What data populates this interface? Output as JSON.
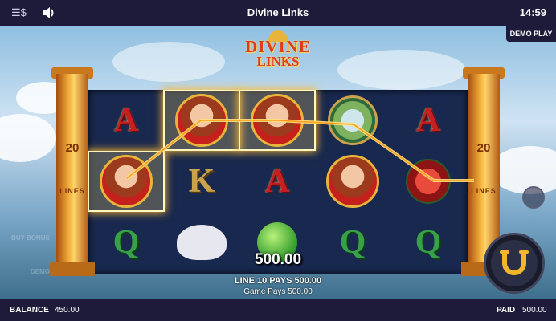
{
  "topbar": {
    "menu_icon": "menu-currency-icon",
    "sound_icon": "speaker-icon",
    "title": "Divine Links",
    "clock": "14:59"
  },
  "demo_badge": "DEMO PLAY",
  "logo": {
    "line1": "DIVINE",
    "line2": "LINKS"
  },
  "pillars": {
    "left_number": "20",
    "left_text": "LINES",
    "right_number": "20",
    "right_text": "LINES"
  },
  "reels": {
    "columns": [
      [
        "A",
        "goddess",
        "Q"
      ],
      [
        "goddess",
        "K",
        "dove"
      ],
      [
        "goddess",
        "A",
        "apple"
      ],
      [
        "wheel",
        "goddess",
        "Q"
      ],
      [
        "A",
        "rose",
        "Q"
      ]
    ],
    "highlighted": [
      "0-1",
      "1-0",
      "2-0"
    ]
  },
  "win": {
    "amount": "500.00",
    "line_pays": "LINE 10 PAYS  500.00",
    "game_pays": "Game Pays  500.00"
  },
  "faded_labels": {
    "bonus": "BUY BONUS",
    "demo": "DEMO"
  },
  "bottombar": {
    "balance_label": "BALANCE",
    "balance_value": "450.00",
    "paid_label": "PAID",
    "paid_value": "500.00"
  },
  "colors": {
    "bar": "#1e1a3a",
    "reel_bg": "#18284e",
    "gold": "#e8b43a",
    "win_line": "#ffb92e"
  }
}
